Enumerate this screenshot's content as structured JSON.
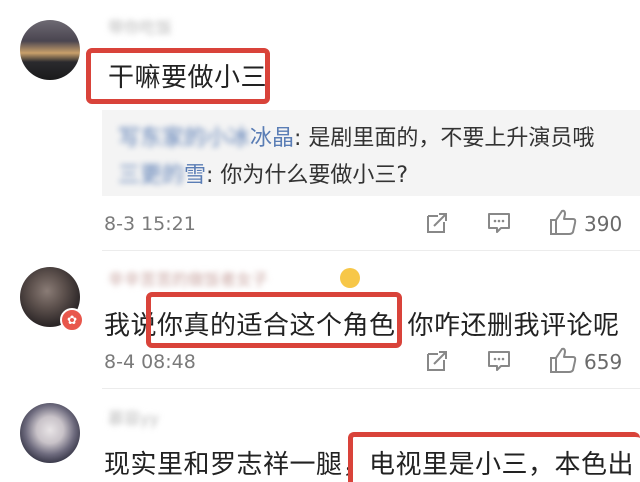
{
  "comments": [
    {
      "username": "带你吃饭",
      "text": "干嘛要做小三",
      "replies": [
        {
          "name": "写东家的小冰",
          "name_tail": "冰晶",
          "text": ": 是剧里面的，不要上升演员哦"
        },
        {
          "name": "三更的",
          "name_tail": "雪",
          "text": ": 你为什么要做小三?"
        }
      ],
      "date": "8-3 15:21",
      "likes": "390"
    },
    {
      "username": "辛辛苦苦的做饭者女子",
      "text_before": "我说",
      "text_highlight": "你真的适合这个角色",
      "text_after": "你咋还删我评论呢",
      "date": "8-4 08:48",
      "likes": "659"
    },
    {
      "username": "慕容yy",
      "text_before": "现实里和罗志祥一腿，",
      "text_highlight": "电视里是小三，本色出"
    }
  ],
  "icons": [
    "share-icon",
    "comment-icon",
    "like-icon",
    "verified-badge-icon"
  ],
  "colors": {
    "highlight": "#d9433a",
    "reply_name": "#5a7db5",
    "badge": "#e8574c"
  }
}
